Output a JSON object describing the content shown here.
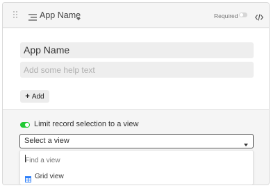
{
  "header": {
    "field_name": "App Name",
    "required_label": "Required",
    "required_enabled": false,
    "icons": {
      "drag": "drag-handle-icon",
      "field_type": "long-text-icon",
      "caret": "caret-down-icon",
      "code": "code-icon"
    }
  },
  "body": {
    "name_value": "App Name",
    "help_placeholder": "Add some help text",
    "add_label": "Add"
  },
  "footer": {
    "limit_label": "Limit record selection to a view",
    "limit_enabled": true,
    "select_value": "Select a view",
    "dropdown": {
      "search_placeholder": "Find a view",
      "options": [
        {
          "label": "Grid view",
          "icon": "grid-view-icon"
        }
      ]
    }
  },
  "colors": {
    "toggle_on": "#20c933",
    "toggle_off": "#d6d6d6",
    "grid_icon": "#2d7ff9",
    "panel_bg": "#f5f5f5"
  }
}
